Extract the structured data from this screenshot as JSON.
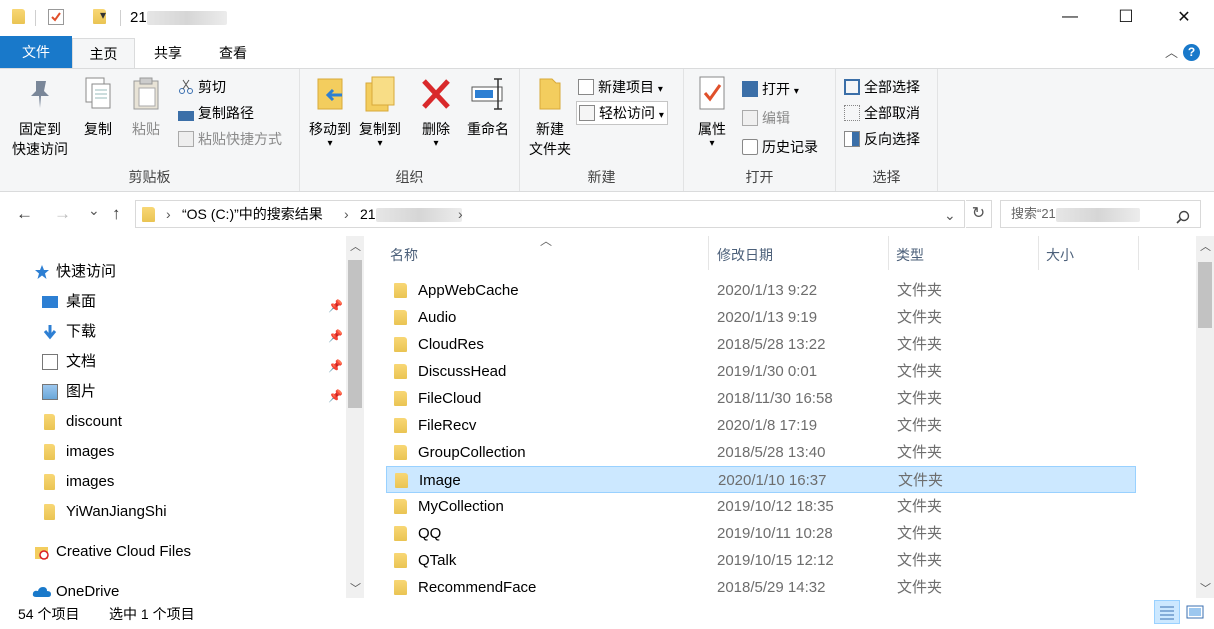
{
  "window": {
    "title_prefix": "21",
    "controls": {
      "minimize": "—",
      "maximize": "☐",
      "close": "✕"
    },
    "quick_access_dropdown": "▾"
  },
  "tabs": {
    "file": "文件",
    "home": "主页",
    "share": "共享",
    "view": "查看",
    "help": "?",
    "collapse": "︿"
  },
  "ribbon": {
    "clipboard": {
      "label": "剪贴板",
      "pin_line1": "固定到",
      "pin_line2": "快速访问",
      "copy": "复制",
      "paste": "粘贴",
      "cut": "剪切",
      "copy_path": "复制路径",
      "paste_shortcut": "粘贴快捷方式"
    },
    "organize": {
      "label": "组织",
      "move_to": "移动到",
      "copy_to": "复制到",
      "delete": "删除",
      "rename": "重命名",
      "dropdown": "▾"
    },
    "new": {
      "label": "新建",
      "new_folder_line1": "新建",
      "new_folder_line2": "文件夹",
      "new_item": "新建项目",
      "easy_access": "轻松访问",
      "dropdown": "▾"
    },
    "open": {
      "label": "打开",
      "properties": "属性",
      "open": "打开",
      "edit": "编辑",
      "history": "历史记录",
      "dropdown": "▾"
    },
    "select": {
      "label": "选择",
      "select_all": "全部选择",
      "select_none": "全部取消",
      "invert": "反向选择"
    }
  },
  "address": {
    "back": "←",
    "forward": "→",
    "recent": "⌄",
    "up": "↑",
    "crumb1": "“OS (C:)”中的搜索结果",
    "crumb2_prefix": "21",
    "sep": "›",
    "dropdown": "⌄",
    "refresh": "↻",
    "search_prefix": "搜索“21",
    "search_icon": "magnifier-icon"
  },
  "nav": {
    "quick_access": "快速访问",
    "items": [
      {
        "label": "桌面",
        "icon": "desktop-icon",
        "pinned": true
      },
      {
        "label": "下载",
        "icon": "download-icon",
        "pinned": true
      },
      {
        "label": "文档",
        "icon": "document-icon",
        "pinned": true
      },
      {
        "label": "图片",
        "icon": "pictures-icon",
        "pinned": true
      },
      {
        "label": "discount",
        "icon": "folder-icon",
        "pinned": false
      },
      {
        "label": "images",
        "icon": "folder-icon",
        "pinned": false
      },
      {
        "label": "images",
        "icon": "folder-icon",
        "pinned": false
      },
      {
        "label": "YiWanJiangShi",
        "icon": "folder-icon",
        "pinned": false
      }
    ],
    "creative_cloud": "Creative Cloud Files",
    "onedrive": "OneDrive",
    "pin_glyph": "📌"
  },
  "list": {
    "columns": {
      "name": "名称",
      "date": "修改日期",
      "type": "类型",
      "size": "大小"
    },
    "sort_glyph": "︿",
    "rows": [
      {
        "name": "AppWebCache",
        "date": "2020/1/13 9:22",
        "type": "文件夹"
      },
      {
        "name": "Audio",
        "date": "2020/1/13 9:19",
        "type": "文件夹"
      },
      {
        "name": "CloudRes",
        "date": "2018/5/28 13:22",
        "type": "文件夹"
      },
      {
        "name": "DiscussHead",
        "date": "2019/1/30 0:01",
        "type": "文件夹"
      },
      {
        "name": "FileCloud",
        "date": "2018/11/30 16:58",
        "type": "文件夹"
      },
      {
        "name": "FileRecv",
        "date": "2020/1/8 17:19",
        "type": "文件夹"
      },
      {
        "name": "GroupCollection",
        "date": "2018/5/28 13:40",
        "type": "文件夹"
      },
      {
        "name": "Image",
        "date": "2020/1/10 16:37",
        "type": "文件夹",
        "selected": true
      },
      {
        "name": "MyCollection",
        "date": "2019/10/12 18:35",
        "type": "文件夹"
      },
      {
        "name": "QQ",
        "date": "2019/10/11 10:28",
        "type": "文件夹"
      },
      {
        "name": "QTalk",
        "date": "2019/10/15 12:12",
        "type": "文件夹"
      },
      {
        "name": "RecommendFace",
        "date": "2018/5/29 14:32",
        "type": "文件夹"
      }
    ]
  },
  "status": {
    "count": "54 个项目",
    "selected": "选中 1 个项目"
  },
  "colors": {
    "accent": "#1979ca",
    "selection": "#cce8ff",
    "selection_border": "#99d1ff"
  }
}
